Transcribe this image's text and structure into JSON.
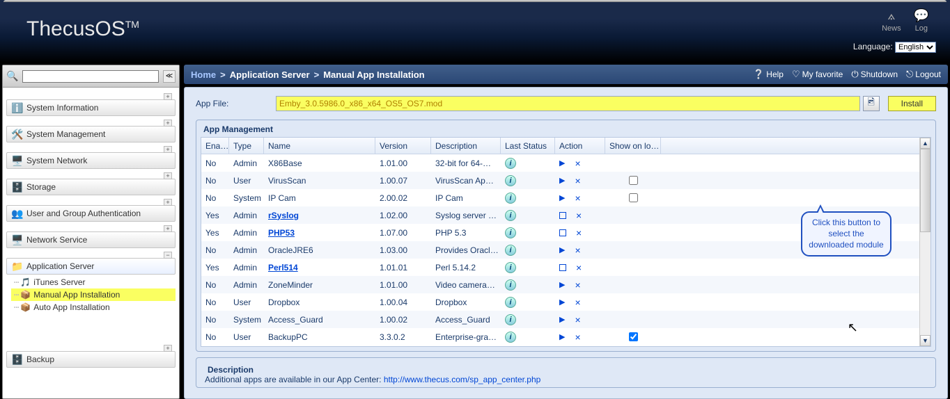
{
  "header": {
    "logo": "ThecusOS",
    "logo_sup": "TM",
    "icons": {
      "news": "News",
      "log": "Log"
    },
    "lang_label": "Language:",
    "lang_value": "English"
  },
  "sidebar": {
    "search": "",
    "groups": [
      {
        "label": "System Information",
        "icon": "ℹ️"
      },
      {
        "label": "System Management",
        "icon": "🛠️"
      },
      {
        "label": "System Network",
        "icon": "🖥️"
      },
      {
        "label": "Storage",
        "icon": "🗄️"
      },
      {
        "label": "User and Group Authentication",
        "icon": "👥"
      },
      {
        "label": "Network Service",
        "icon": "🖥️"
      }
    ],
    "app_server": {
      "label": "Application Server",
      "icon": "📁",
      "children": [
        {
          "label": "iTunes Server",
          "icon": "🎵"
        },
        {
          "label": "Manual App Installation",
          "icon": "📦",
          "hl": true
        },
        {
          "label": "Auto App Installation",
          "icon": "📦"
        }
      ]
    },
    "backup": {
      "label": "Backup",
      "icon": "🗄️"
    }
  },
  "breadcrumb": {
    "home": "Home",
    "l1": "Application Server",
    "l2": "Manual App Installation",
    "tools": {
      "help": "Help",
      "fav": "My favorite",
      "shutdown": "Shutdown",
      "logout": "Logout"
    }
  },
  "panel": {
    "app_file_label": "App File:",
    "app_file_value": "Emby_3.0.5986.0_x86_x64_OS5_OS7.mod",
    "install_label": "Install",
    "fieldset_title": "App Management",
    "columns": {
      "ena": "Ena…",
      "type": "Type",
      "name": "Name",
      "ver": "Version",
      "desc": "Description",
      "ls": "Last Status",
      "act": "Action",
      "show": "Show on lo…"
    },
    "rows": [
      {
        "ena": "No",
        "type": "Admin",
        "name": "X86Base",
        "link": false,
        "ver": "1.01.00",
        "desc": "32-bit for 64-…",
        "running": false,
        "chk": null
      },
      {
        "ena": "No",
        "type": "User",
        "name": "VirusScan",
        "link": false,
        "ver": "1.00.07",
        "desc": "VirusScan Ap…",
        "running": false,
        "chk": false
      },
      {
        "ena": "No",
        "type": "System",
        "name": "IP Cam",
        "link": false,
        "ver": "2.00.02",
        "desc": "IP Cam",
        "running": false,
        "chk": false
      },
      {
        "ena": "Yes",
        "type": "Admin",
        "name": "rSyslog",
        "link": true,
        "ver": "1.02.00",
        "desc": "Syslog server …",
        "running": true,
        "chk": null
      },
      {
        "ena": "Yes",
        "type": "Admin",
        "name": "PHP53",
        "link": true,
        "ver": "1.07.00",
        "desc": "PHP 5.3",
        "running": true,
        "chk": null
      },
      {
        "ena": "No",
        "type": "Admin",
        "name": "OracleJRE6",
        "link": false,
        "ver": "1.03.00",
        "desc": "Provides Oracl…",
        "running": false,
        "chk": null
      },
      {
        "ena": "Yes",
        "type": "Admin",
        "name": "Perl514",
        "link": true,
        "ver": "1.01.01",
        "desc": "Perl 5.14.2",
        "running": true,
        "chk": null
      },
      {
        "ena": "No",
        "type": "Admin",
        "name": "ZoneMinder",
        "link": false,
        "ver": "1.01.00",
        "desc": "Video camera…",
        "running": false,
        "chk": null
      },
      {
        "ena": "No",
        "type": "User",
        "name": "Dropbox",
        "link": false,
        "ver": "1.00.04",
        "desc": "Dropbox",
        "running": false,
        "chk": null
      },
      {
        "ena": "No",
        "type": "System",
        "name": "Access_Guard",
        "link": false,
        "ver": "1.00.02",
        "desc": "Access_Guard",
        "running": false,
        "chk": null
      },
      {
        "ena": "No",
        "type": "User",
        "name": "BackupPC",
        "link": false,
        "ver": "3.3.0.2",
        "desc": "Enterprise-gra…",
        "running": false,
        "chk": true
      }
    ],
    "desc_title": "Description",
    "desc_text": "Additional apps are available in our App Center: ",
    "desc_link": "http://www.thecus.com/sp_app_center.php"
  },
  "callout": "Click this button to select the downloaded module"
}
